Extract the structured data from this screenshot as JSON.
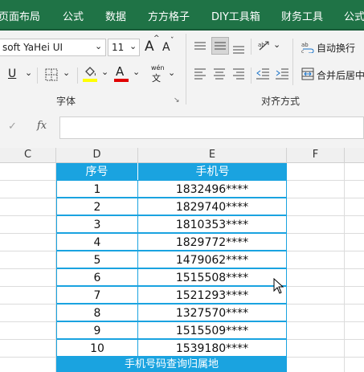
{
  "ribbon_tabs": [
    "页面布局",
    "公式",
    "数据",
    "方方格子",
    "DIY工具箱",
    "财务工具",
    "公式"
  ],
  "font": {
    "font_name": "soft YaHei UI",
    "font_size": "11",
    "group_label": "字体",
    "grow_glyph": "A",
    "shrink_glyph": "A",
    "underline_glyph": "U",
    "font_color_glyph": "A",
    "phonetic_top": "wén",
    "phonetic_bottom": "文",
    "highlight_color": "#ffff00",
    "font_color": "#e00000"
  },
  "alignment": {
    "group_label": "对齐方式",
    "wrap_text_label": "自动换行",
    "merge_center_label": "合并后居中"
  },
  "formula_bar": {
    "cancel_glyph": "✓",
    "fx_glyph": "fx",
    "value": ""
  },
  "columns": [
    "C",
    "D",
    "E",
    "F"
  ],
  "table": {
    "headers": [
      "序号",
      "手机号"
    ],
    "rows": [
      [
        "1",
        "1832496****"
      ],
      [
        "2",
        "1829740****"
      ],
      [
        "3",
        "1810353****"
      ],
      [
        "4",
        "1829772****"
      ],
      [
        "5",
        "1479062****"
      ],
      [
        "6",
        "1515508****"
      ],
      [
        "7",
        "1521293****"
      ],
      [
        "8",
        "1327570****"
      ],
      [
        "9",
        "1515509****"
      ],
      [
        "10",
        "1539180****"
      ]
    ],
    "footer": "手机号码查询归属地",
    "accent": "#1aa3e0"
  },
  "colors": {
    "ribbon_green": "#1f7346"
  }
}
